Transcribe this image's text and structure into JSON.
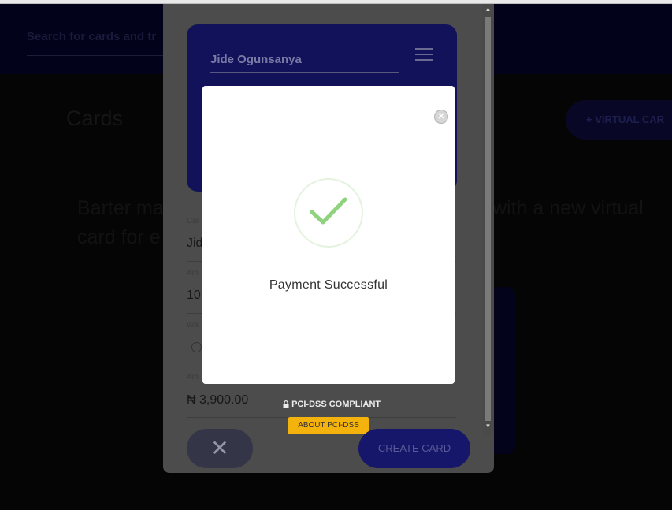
{
  "background": {
    "search_placeholder": "Search for cards and tr",
    "page_title": "Cards",
    "virtual_card_button": "+ VIRTUAL CAR",
    "intro_line1": "Barter ma",
    "intro_line1_right": "with a new virtual",
    "intro_line2": "card for e"
  },
  "create_card_modal": {
    "card_holder": "Jide Ogunsanya",
    "card_name_label": "Car",
    "card_name_value": "Jid",
    "amount_label": "Am",
    "amount_value": "10",
    "wallet_label": "Wal",
    "amount_total_label": "Am",
    "amount_total_value": "₦ 3,900.00",
    "pci_text": "PCI-DSS COMPLIANT",
    "pci_button": "ABOUT PCI-DSS",
    "close_symbol": "✕",
    "create_button": "CREATE CARD"
  },
  "success_dialog": {
    "message": "Payment Successful",
    "close_symbol": "✕"
  },
  "icons": {
    "success": "check-icon",
    "close": "close-circle-icon",
    "menu": "hamburger-menu-icon",
    "lock": "lock-icon"
  },
  "colors": {
    "primary_navy": "#12125a",
    "success_green": "#8fd37e",
    "pci_badge": "#f3b30c"
  }
}
